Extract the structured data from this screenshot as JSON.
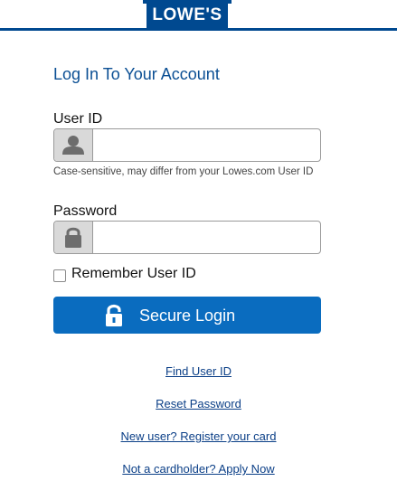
{
  "header": {
    "logo_text": "LOWE'S",
    "brand_color": "#004990"
  },
  "login": {
    "title": "Log In To Your Account",
    "user_id_label": "User ID",
    "user_id_value": "",
    "user_id_hint": "Case-sensitive, may differ from your Lowes.com User ID",
    "password_label": "Password",
    "password_value": "",
    "remember_label": "Remember User ID",
    "remember_checked": false,
    "submit_label": "Secure Login",
    "submit_color": "#0a6cbf",
    "user_icon": "user-icon",
    "lock_icon": "lock-icon"
  },
  "links": {
    "find_user_id": "Find User ID",
    "reset_password": "Reset Password",
    "register": "New user? Register your card",
    "apply": "Not a cardholder? Apply Now"
  }
}
